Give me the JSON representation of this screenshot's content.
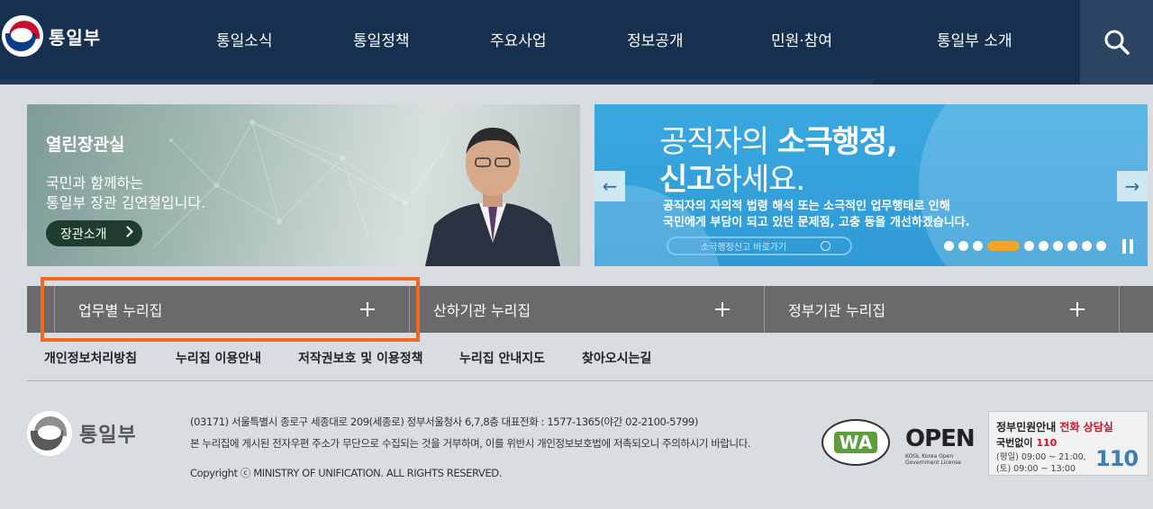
{
  "header": {
    "logo_text": "통일부",
    "nav": [
      "통일소식",
      "통일정책",
      "주요사업",
      "정보공개",
      "민원·참여",
      "통일부 소개"
    ]
  },
  "minister_banner": {
    "title": "열린장관실",
    "desc_line1": "국민과 함께하는",
    "desc_line2": "통일부 장관 김연철입니다.",
    "button": "장관소개"
  },
  "slide_banner": {
    "h1_normal": "공직자의 ",
    "h1_bold": "소극행정,",
    "h2_bold": "신고",
    "h2_normal": "하세요.",
    "desc_line1": "공직자의 자의적 법령 해석 또는 소극적인 업무행태로 인해",
    "desc_line2": "국민에게 부담이 되고 있던 문제점, 고충 등을 개선하겠습니다.",
    "link": "소극행정신고 바로가기",
    "prev_symbol": "←",
    "next_symbol": "→",
    "dot_count": 10,
    "active_dot_index": 3
  },
  "site_links": [
    "업무별 누리집",
    "산하기관 누리집",
    "정부기관 누리집"
  ],
  "footer_links": [
    "개인정보처리방침",
    "누리집 이용안내",
    "저작권보호 및 이용정책",
    "누리집 안내지도",
    "찾아오시는길"
  ],
  "footer": {
    "logo_text": "통일부",
    "address": "(03171) 서울특별시 종로구 세종대로 209(세종로) 정부서울청사 6,7,8층 대표전화 : 1577-1365(야간 02-2100-5799)",
    "notice": "본 누리집에 게시된 전자우편 주소가 무단으로 수집되는 것을 거부하며, 이를 위반시 개인정보보호법에 저촉되오니 주의하시기 바랍니다.",
    "copyright": "Copyright ⓒ MINISTRY OF UNIFICATION. ALL RIGHTS RESERVED.",
    "wa_mark": "WA",
    "open_mark": "OPEN",
    "open_sub": "KOGL Korea Open Government License",
    "call_title": "정부민원안내 ",
    "call_title_red": "전화 상담실",
    "call_num": "국번없이 ",
    "call_num_red": "110",
    "call_hours1": "(평일) 09:00 ~ 21:00,",
    "call_hours2": "(토) 09:00 ~ 13:00",
    "call_logo": "110"
  }
}
